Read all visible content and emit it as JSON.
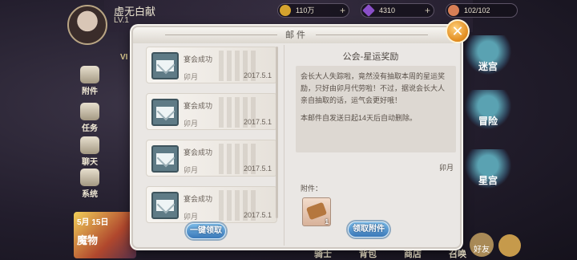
{
  "hud": {
    "player_name": "虚无白献",
    "level": "LV.1",
    "vip": "VI",
    "resources": [
      {
        "icon": "gold-coin-icon",
        "value": "110万"
      },
      {
        "icon": "gem-icon",
        "value": "4310"
      },
      {
        "icon": "stamina-icon",
        "value": "102/102"
      }
    ],
    "side_menu": [
      "附件",
      "任务",
      "聊天",
      "系统"
    ],
    "right_menu": [
      "迷宫",
      "冒险",
      "星宫"
    ],
    "bottom_menu": [
      "骑士",
      "背包",
      "商店",
      "召唤"
    ],
    "friend_label": "好友",
    "banner_text": "5月 15日",
    "banner_title": "魔物"
  },
  "dialog": {
    "title": "邮件",
    "mails": [
      {
        "subject": "宴会成功",
        "sender": "卯月",
        "date": "2017.5.1"
      },
      {
        "subject": "宴会成功",
        "sender": "卯月",
        "date": "2017.5.1"
      },
      {
        "subject": "宴会成功",
        "sender": "卯月",
        "date": "2017.5.1"
      },
      {
        "subject": "宴会成功",
        "sender": "卯月",
        "date": "2017.5.1"
      }
    ],
    "detail": {
      "title": "公会-星运奖励",
      "body": "会长大人失踪啦，竟然没有抽取本周的星运奖励，只好由卯月代劳啦！不过，据说会长大人亲自抽取的话，运气会更好哦！",
      "note": "本邮件自发送日起14天后自动删除。",
      "signature": "卯月",
      "attachment_label": "附件：",
      "attachment_qty": "1"
    },
    "claim_all_label": "一键领取",
    "claim_label": "领取附件"
  },
  "colors": {
    "accent_button": "#4a8ac8",
    "close_button": "#e8961f"
  }
}
